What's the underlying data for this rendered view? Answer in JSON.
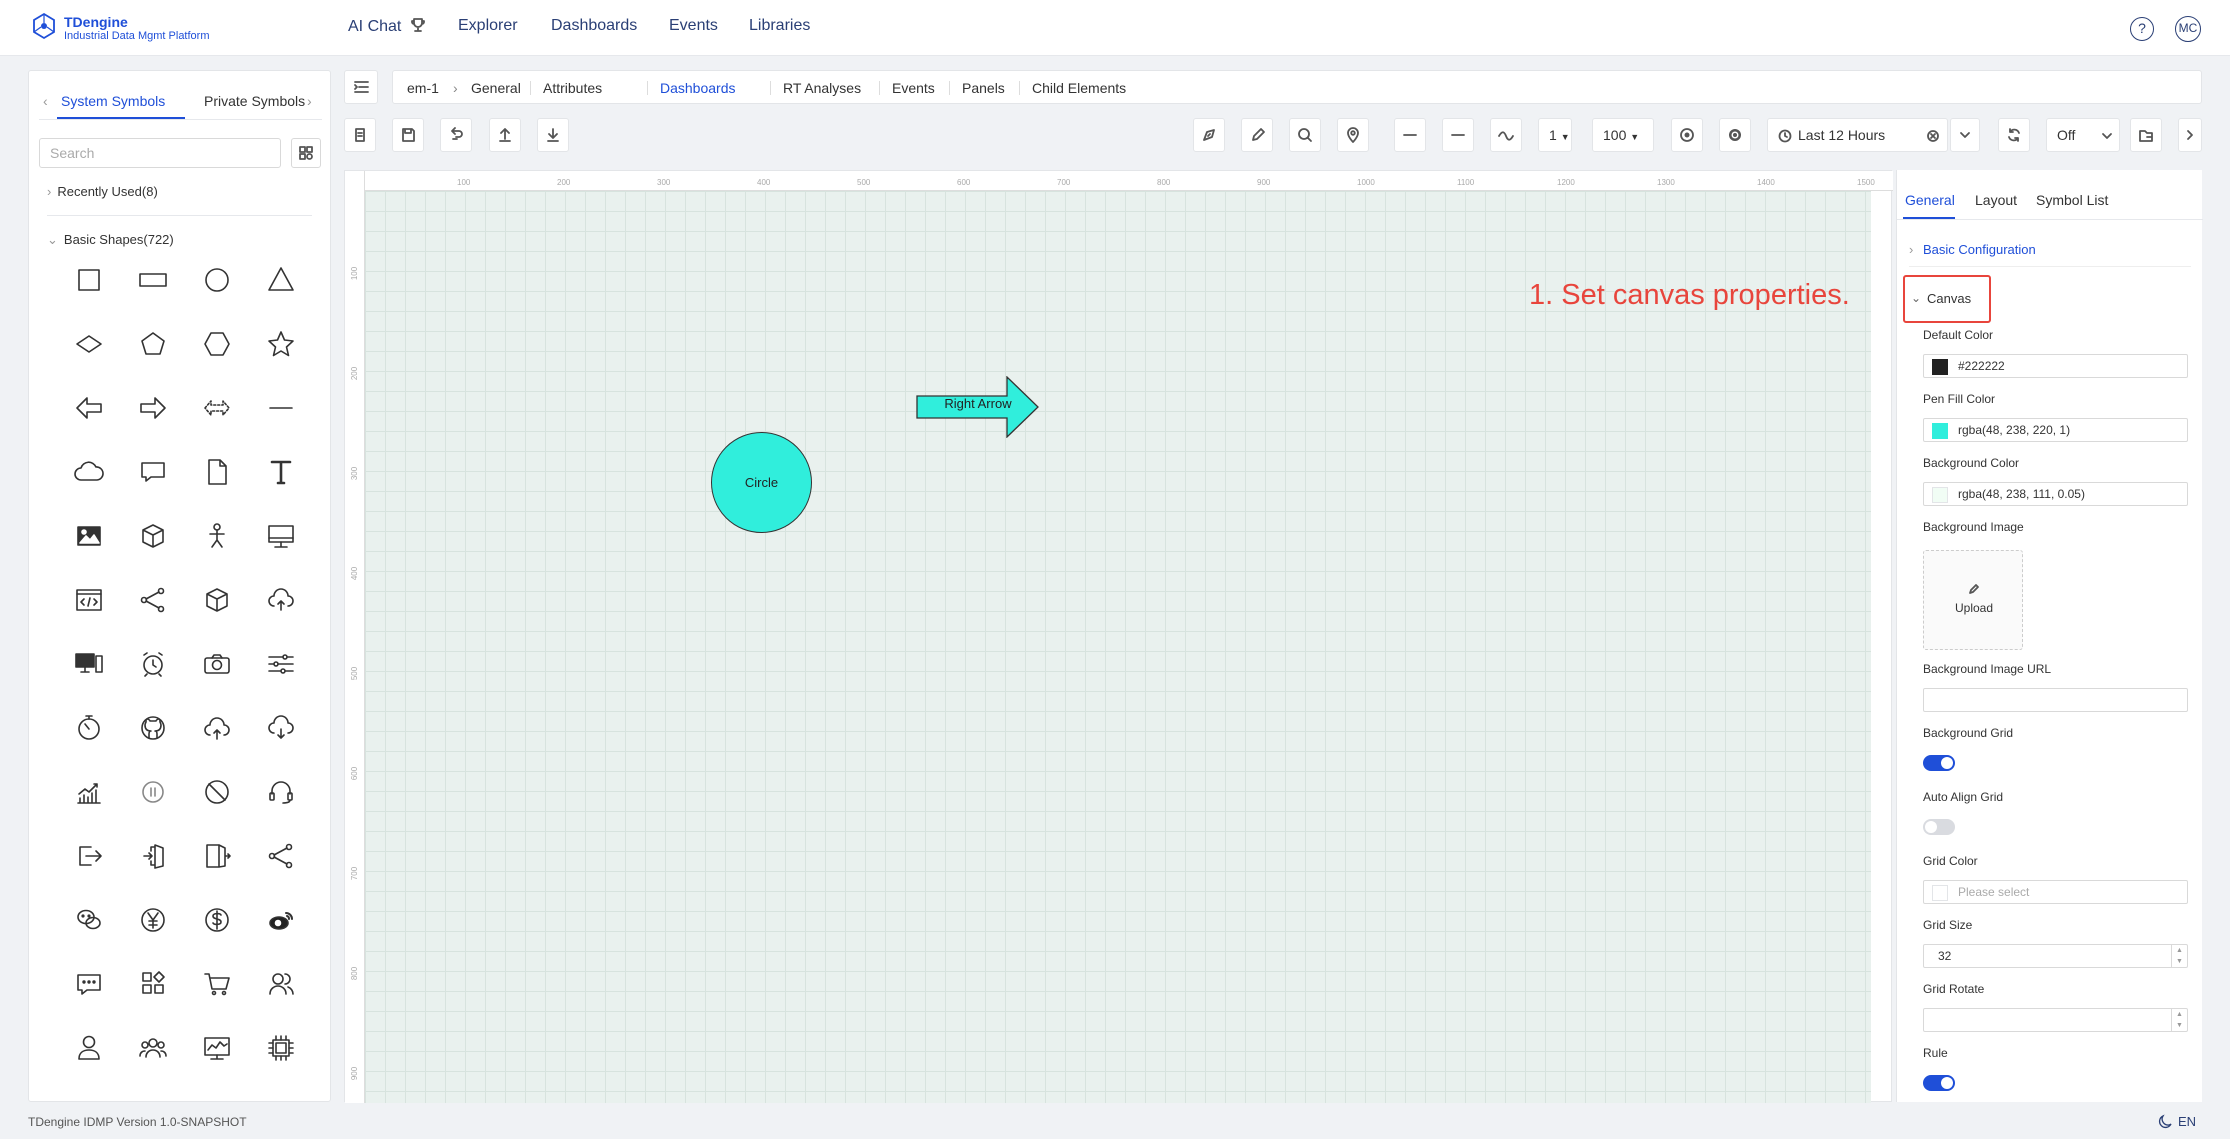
{
  "app": {
    "logo_title": "TDengine",
    "logo_subtitle": "Industrial Data Mgmt Platform"
  },
  "nav": {
    "ai_chat": "AI Chat",
    "explorer": "Explorer",
    "dashboards": "Dashboards",
    "events": "Events",
    "libraries": "Libraries",
    "help": "?",
    "avatar": "MC"
  },
  "left_panel": {
    "tabs": [
      "System Symbols",
      "Private Symbols"
    ],
    "search_placeholder": "Search",
    "recently_used": "Recently Used(8)",
    "basic_shapes": "Basic Shapes(722)",
    "icons": [
      "square-icon",
      "rectangle-icon",
      "circle-icon",
      "triangle-icon",
      "diamond-icon",
      "pentagon-icon",
      "hexagon-icon",
      "star-icon",
      "left-arrow-icon",
      "right-arrow-icon",
      "double-arrow-icon",
      "line-icon",
      "cloud-icon",
      "message-icon",
      "document-icon",
      "text-icon",
      "image-icon",
      "cube-icon",
      "person-icon",
      "monitor-icon",
      "code-icon",
      "share-icon",
      "box-icon",
      "cloud-upload-icon",
      "computer-icon",
      "alarm-clock-icon",
      "camera-icon",
      "settings-sliders-icon",
      "timer-icon",
      "github-icon",
      "upload-cloud-icon",
      "download-cloud-icon",
      "chart-icon",
      "pause-icon",
      "ban-icon",
      "headset-icon",
      "logout-icon",
      "door-icon",
      "exit-icon",
      "share-nodes-icon",
      "wechat-icon",
      "yen-icon",
      "dollar-icon",
      "weibo-icon",
      "comment-dots-icon",
      "apps-icon",
      "cart-icon",
      "users-icon",
      "user-icon",
      "team-icon",
      "monitor-chart-icon",
      "chip-icon"
    ]
  },
  "breadcrumb": {
    "root": "em-1",
    "items": [
      "General",
      "Attributes",
      "Dashboards",
      "RT Analyses",
      "Events",
      "Panels",
      "Child Elements"
    ],
    "active_index": 2
  },
  "toolbar": {
    "line_width": "1",
    "zoom": "100",
    "time_range": "Last 12 Hours",
    "refresh": "Off"
  },
  "canvas": {
    "ruler_x": [
      "100",
      "200",
      "300",
      "400",
      "500",
      "600",
      "700",
      "800",
      "900",
      "1000",
      "1100",
      "1200",
      "1300",
      "1400",
      "1500"
    ],
    "ruler_y": [
      "100",
      "200",
      "300",
      "400",
      "500",
      "600",
      "700",
      "800",
      "900"
    ],
    "circle_label": "Circle",
    "arrow_label": "Right Arrow",
    "annotation": "1. Set canvas properties.",
    "grid_background": "#e9f1ee",
    "shape_fill": "#30eedc"
  },
  "properties": {
    "tabs": [
      "General",
      "Layout",
      "Symbol List"
    ],
    "basic_configuration": "Basic Configuration",
    "canvas_section": "Canvas",
    "default_color_label": "Default Color",
    "default_color_value": "#222222",
    "pen_fill_label": "Pen Fill Color",
    "pen_fill_value": "rgba(48, 238, 220, 1)",
    "bg_color_label": "Background Color",
    "bg_color_value": "rgba(48, 238, 111, 0.05)",
    "bg_image_label": "Background Image",
    "upload": "Upload",
    "bg_image_url_label": "Background Image URL",
    "bg_grid_label": "Background Grid",
    "bg_grid_on": true,
    "auto_align_label": "Auto Align Grid",
    "auto_align_on": false,
    "grid_color_label": "Grid Color",
    "grid_color_placeholder": "Please select",
    "grid_size_label": "Grid Size",
    "grid_size_value": "32",
    "grid_rotate_label": "Grid Rotate",
    "rule_label": "Rule",
    "rule_on": true
  },
  "footer": {
    "version": "TDengine IDMP Version 1.0-SNAPSHOT",
    "lang": "EN"
  }
}
